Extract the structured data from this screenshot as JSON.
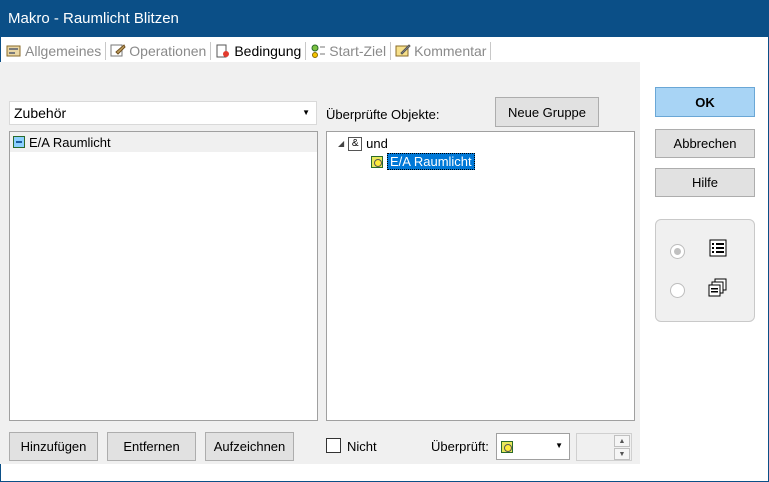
{
  "window": {
    "title": "Makro - Raumlicht Blitzen"
  },
  "tabs": [
    {
      "label": "Allgemeines",
      "icon": "properties-icon",
      "active": false
    },
    {
      "label": "Operationen",
      "icon": "operations-icon",
      "active": false
    },
    {
      "label": "Bedingung",
      "icon": "condition-icon",
      "active": true
    },
    {
      "label": "Start-Ziel",
      "icon": "start-target-icon",
      "active": false
    },
    {
      "label": "Kommentar",
      "icon": "comment-icon",
      "active": false
    }
  ],
  "left": {
    "category": "Zubehör",
    "items": [
      {
        "label": "E/A Raumlicht",
        "icon": "io-icon"
      }
    ]
  },
  "right": {
    "label": "Überprüfte Objekte:",
    "new_group": "Neue Gruppe",
    "tree": {
      "root": "und",
      "children": [
        {
          "label": "E/A Raumlicht",
          "selected": true
        }
      ]
    }
  },
  "buttons": {
    "add": "Hinzufügen",
    "remove": "Entfernen",
    "record": "Aufzeichnen",
    "ok": "OK",
    "cancel": "Abbrechen",
    "help": "Hilfe"
  },
  "bottom": {
    "not_label": "Nicht",
    "not_checked": false,
    "checked_label": "Überprüft:",
    "spin_value": ""
  },
  "view_options": [
    {
      "icon": "list-view-icon",
      "selected": true
    },
    {
      "icon": "copy-view-icon",
      "selected": false
    }
  ],
  "colors": {
    "titlebar": "#0b4f87",
    "ok_button": "#a8d4f5",
    "selection": "#0078d7"
  }
}
